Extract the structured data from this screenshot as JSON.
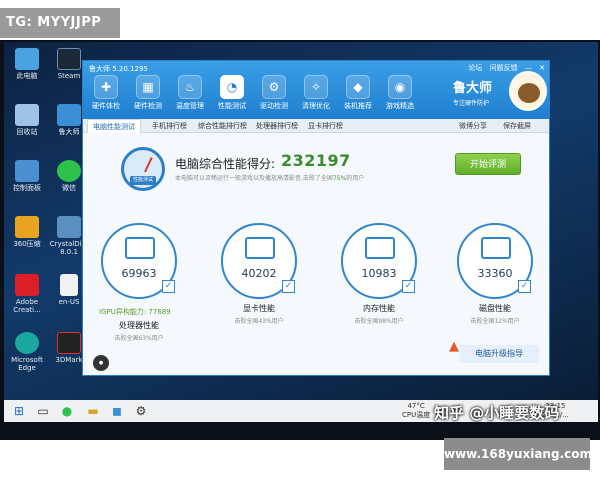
{
  "watermarks": {
    "tg": "TG: MYYJJPP",
    "zhihu": "知乎 @小睡要数码",
    "url": "www.168yuxiang.com"
  },
  "desktop_icons": [
    {
      "label": "此电脑",
      "icon": "computer-icon",
      "color": "#4aa3e0"
    },
    {
      "label": "Steam",
      "icon": "steam-icon",
      "color": "#1b2838"
    },
    {
      "label": "回收站",
      "icon": "recycle-bin-icon",
      "color": "#9fc3e6"
    },
    {
      "label": "鲁大师",
      "icon": "ludashi-icon",
      "color": "#3b8fd6"
    },
    {
      "label": "控制面板",
      "icon": "control-panel-icon",
      "color": "#4a8fd0"
    },
    {
      "label": "微信",
      "icon": "wechat-icon",
      "color": "#2dc24a"
    },
    {
      "label": "360压缩",
      "icon": "360zip-icon",
      "color": "#e8a323"
    },
    {
      "label": "CrystalDi... 8.0.1",
      "icon": "crystaldisk-icon",
      "color": "#5a8fbf"
    },
    {
      "label": "Adobe Creati...",
      "icon": "adobe-cc-icon",
      "color": "#da1f26"
    },
    {
      "label": "en-US",
      "icon": "file-icon",
      "color": "#f2f2f2"
    },
    {
      "label": "Microsoft Edge",
      "icon": "edge-icon",
      "color": "#1aa7a0"
    },
    {
      "label": "3DMark",
      "icon": "3dmark-icon",
      "color": "#222222"
    }
  ],
  "app": {
    "title": "鲁大师 5.20.1295",
    "window_links": [
      "论坛",
      "问题反馈"
    ],
    "toolbar": [
      {
        "label": "硬件体检",
        "icon": "health-check-icon",
        "glyph": "✚"
      },
      {
        "label": "硬件检测",
        "icon": "hardware-scan-icon",
        "glyph": "▦"
      },
      {
        "label": "温度管理",
        "icon": "temperature-icon",
        "glyph": "♨"
      },
      {
        "label": "性能测试",
        "icon": "performance-icon",
        "glyph": "◔",
        "active": true
      },
      {
        "label": "驱动检测",
        "icon": "driver-icon",
        "glyph": "⚙"
      },
      {
        "label": "清理优化",
        "icon": "cleanup-icon",
        "glyph": "✧"
      },
      {
        "label": "装机推荐",
        "icon": "build-recommend-icon",
        "glyph": "◆"
      },
      {
        "label": "游戏精选",
        "icon": "game-icon",
        "glyph": "◉"
      }
    ],
    "brand_name": "鲁大师",
    "brand_slogan": "专注硬件防护",
    "tabs": [
      "电脑性能测试",
      "手机排行榜",
      "综合性能排行榜",
      "处理器排行榜",
      "显卡排行榜"
    ],
    "tab_links": [
      "微博分享",
      "保存截屏"
    ],
    "score": {
      "label": "电脑综合性能得分:",
      "value": "232197",
      "desc_before": "本电脑可以流畅运行一般游戏以及播放高清影音,击败了全国",
      "percent": "75%",
      "desc_after": "的用户",
      "gauge_label": "性能测试"
    },
    "start_button": "开始评测",
    "modules": [
      {
        "name": "处理器性能",
        "score": "69963",
        "rank": "击败全国63%用户",
        "icon": "cpu-monitor-icon"
      },
      {
        "name": "显卡性能",
        "score": "40202",
        "rank": "击败全国43%用户",
        "icon": "gpu-icon"
      },
      {
        "name": "内存性能",
        "score": "10983",
        "rank": "击败全国98%用户",
        "icon": "memory-icon"
      },
      {
        "name": "磁盘性能",
        "score": "33360",
        "rank": "击败全国12%用户",
        "icon": "disk-icon"
      }
    ],
    "igpu_text": "IGPU异构能力: 77689",
    "upgrade_label": "电脑升级指导"
  },
  "taskbar": {
    "tray_temp": "47°C",
    "tray_cpu": "CPU温度",
    "clock_time": "23:15",
    "clock_date": "2021/..."
  }
}
